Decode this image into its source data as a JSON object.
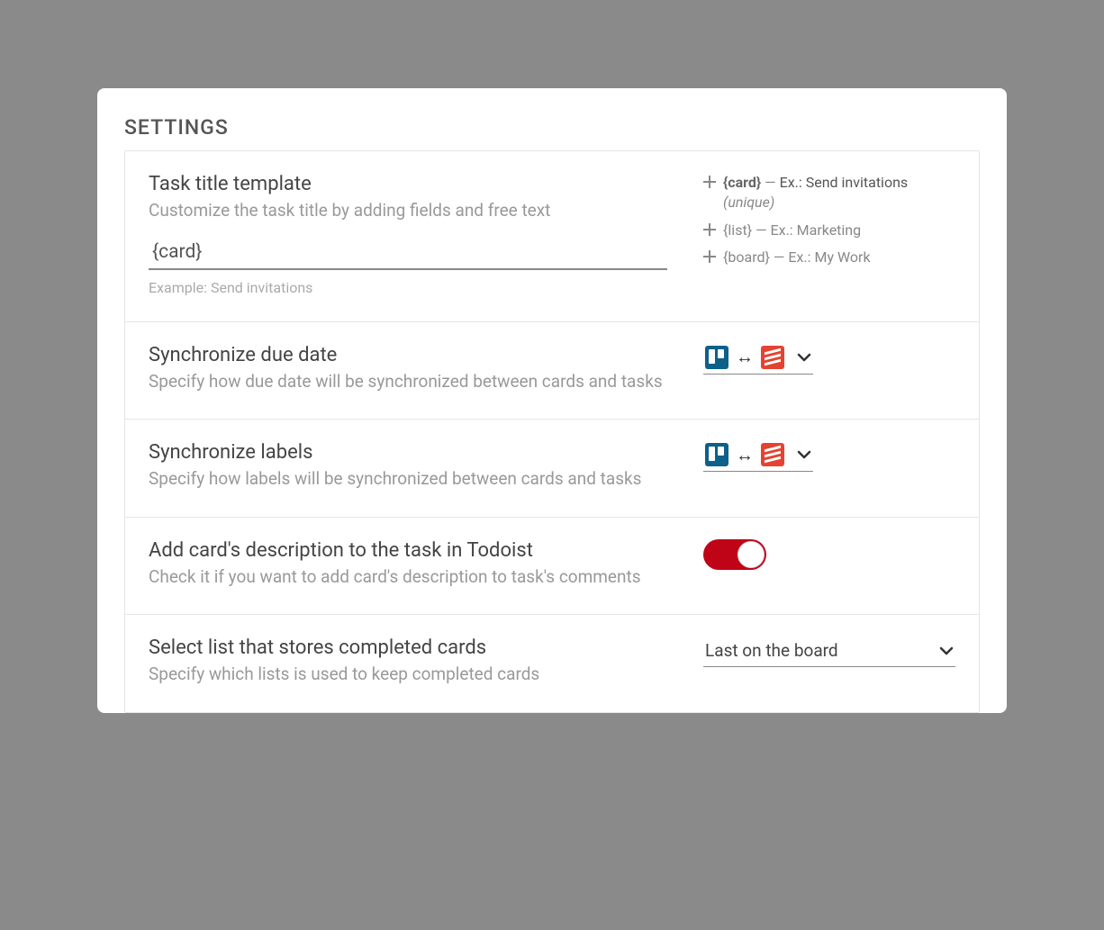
{
  "header": "Settings",
  "task_title": {
    "title": "Task title template",
    "desc": "Customize the task title by adding fields and free text",
    "value": "{card}",
    "example_prefix": "Example: ",
    "example_value": "Send invitations",
    "fields": [
      {
        "token": "{card}",
        "sep": " — ",
        "ex_prefix": "Ex.: ",
        "ex": "Send invitations",
        "unique": " (unique)",
        "active": true
      },
      {
        "token": "{list}",
        "sep": " — ",
        "ex_prefix": "Ex.: ",
        "ex": "Marketing",
        "unique": "",
        "active": false
      },
      {
        "token": "{board}",
        "sep": " — ",
        "ex_prefix": "Ex.: ",
        "ex": "My Work",
        "unique": "",
        "active": false
      }
    ]
  },
  "sync_due": {
    "title": "Synchronize due date",
    "desc": "Specify how due date will be synchronized between cards and tasks"
  },
  "sync_labels": {
    "title": "Synchronize labels",
    "desc": "Specify how labels will be synchronized between cards and tasks"
  },
  "add_desc": {
    "title": "Add card's description to the task in Todoist",
    "desc": "Check it if you want to add card's description to task's comments",
    "enabled": true
  },
  "completed_list": {
    "title": "Select list that stores completed cards",
    "desc": "Specify which lists is used to keep completed cards",
    "value": "Last on the board"
  }
}
